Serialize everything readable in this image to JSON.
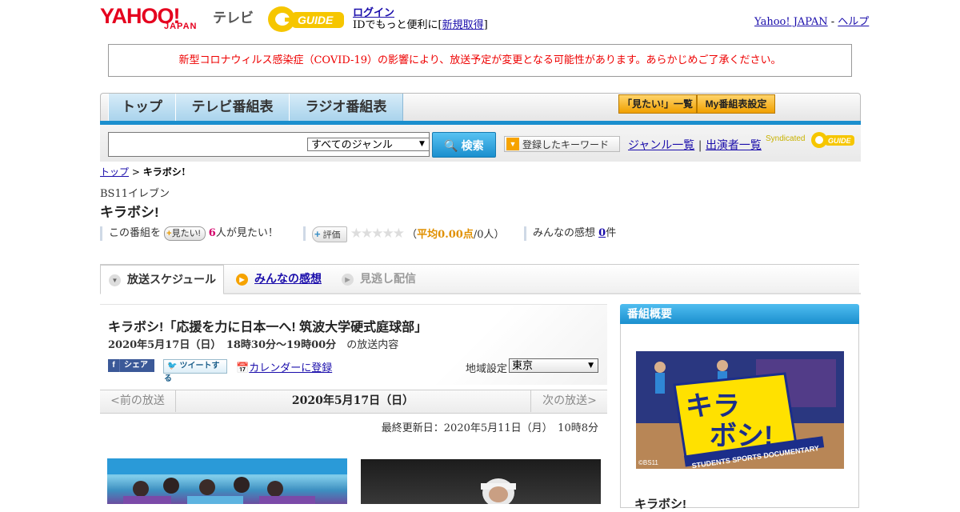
{
  "header": {
    "logo_yahoo": "YAHOO!",
    "logo_japan": "JAPAN",
    "logo_tv": "テレビ",
    "gguide_logo": "GUIDE",
    "login": "ログイン",
    "login_sub_prefix": "IDでもっと便利に[",
    "register": "新規取得",
    "login_sub_suffix": "]",
    "yahoo_japan_link": "Yahoo! JAPAN",
    "separator": " - ",
    "help_link": "ヘルプ"
  },
  "notice": "新型コロナウィルス感染症（COVID-19）の影響により、放送予定が変更となる可能性があります。あらかじめご了承ください。",
  "nav": {
    "tabs": [
      "トップ",
      "テレビ番組表",
      "ラジオ番組表"
    ],
    "mitai_list": "「見たい!」一覧",
    "my_settings": "My番組表設定"
  },
  "search": {
    "input_value": "",
    "genre_selected": "すべてのジャンル",
    "button": "検索",
    "keyword_button": "登録したキーワード",
    "genre_list": "ジャンル一覧",
    "link_sep": "|",
    "performer_list": "出演者一覧",
    "syndicated": "Syndicated",
    "syndicated_logo": "GUIDE"
  },
  "breadcrumb": {
    "top": "トップ",
    "sep": " > ",
    "current": "キラボシ!"
  },
  "program": {
    "channel": "BS11イレブン",
    "title": "キラボシ!",
    "mitai_prefix": "この番組を",
    "mitai_button": "見たい!",
    "mitai_count": "6",
    "mitai_suffix": "人が見たい！",
    "rating_button": "評価",
    "stars": "★★★★★",
    "rating_open": "（",
    "rating_avg_label": "平均0.00点",
    "rating_count": "/0人）",
    "comments_label": "みんなの感想",
    "comments_count": "0",
    "comments_unit": "件"
  },
  "subnav": {
    "schedule": "放送スケジュール",
    "comments": "みんなの感想",
    "vod": "見逃し配信"
  },
  "episode": {
    "title": "キラボシ!「応援を力に日本一へ! 筑波大学硬式庭球部」",
    "date_time": "2020年5月17日（日）　18時30分～19時00分",
    "date_suffix": "の放送内容",
    "share_fb": "シェア",
    "share_tw": "ツイートする",
    "calendar": "カレンダーに登録",
    "region_label": "地域設定",
    "region_value": "東京"
  },
  "pager": {
    "prev": "<前の放送",
    "date": "2020年5月17日（日）",
    "next": "次の放送>"
  },
  "updated": "最終更新日：2020年5月11日（月）　10時8分",
  "sidebar": {
    "heading": "番組概要",
    "image_logo_top": "キラ",
    "image_logo_bottom": "ボシ!",
    "image_caption": "STUDENTS SPORTS DOCUMENTARY",
    "image_copyright": "©BS11",
    "program_title": "キラボシ!"
  },
  "colors": {
    "accent_blue": "#1b8fce",
    "notice_red": "#e00000",
    "yahoo_red": "#e5001e",
    "orange": "#f0a000"
  }
}
